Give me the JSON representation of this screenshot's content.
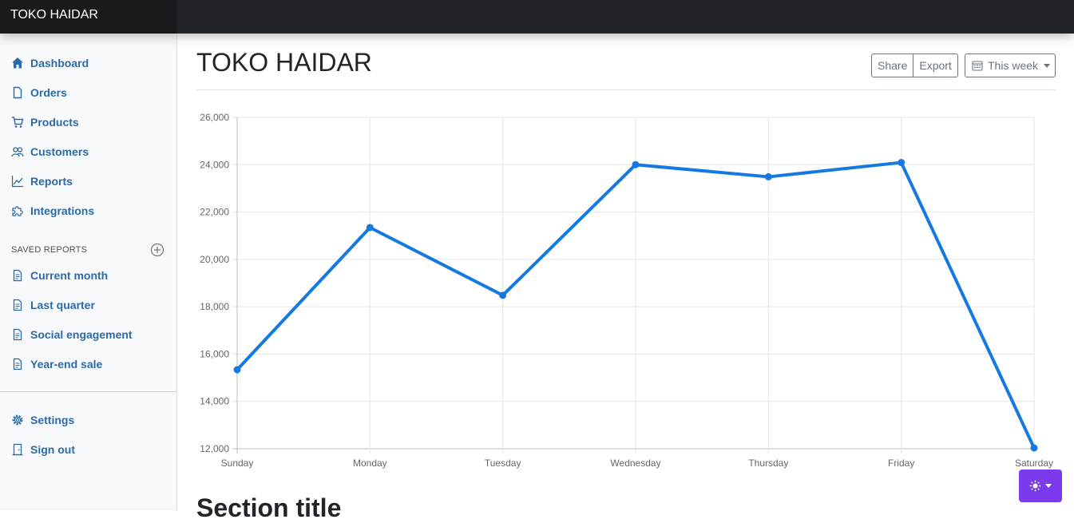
{
  "brand": "TOKO HAIDAR",
  "sidebar": {
    "items": [
      {
        "label": "Dashboard",
        "icon": "home-icon"
      },
      {
        "label": "Orders",
        "icon": "file-icon"
      },
      {
        "label": "Products",
        "icon": "cart-icon"
      },
      {
        "label": "Customers",
        "icon": "users-icon"
      },
      {
        "label": "Reports",
        "icon": "chart-line-icon"
      },
      {
        "label": "Integrations",
        "icon": "puzzle-icon"
      }
    ],
    "saved_heading": "SAVED REPORTS",
    "saved_items": [
      {
        "label": "Current month",
        "icon": "file-text-icon"
      },
      {
        "label": "Last quarter",
        "icon": "file-text-icon"
      },
      {
        "label": "Social engagement",
        "icon": "file-text-icon"
      },
      {
        "label": "Year-end sale",
        "icon": "file-text-icon"
      }
    ],
    "bottom_items": [
      {
        "label": "Settings",
        "icon": "gear-icon"
      },
      {
        "label": "Sign out",
        "icon": "door-icon"
      }
    ]
  },
  "main": {
    "title": "TOKO HAIDAR",
    "share_label": "Share",
    "export_label": "Export",
    "period_label": "This week",
    "section_title": "Section title"
  },
  "colors": {
    "accent": "#0d6efd",
    "line": "#1479e0",
    "theme_button": "#7c3aed"
  },
  "chart_data": {
    "type": "line",
    "categories": [
      "Sunday",
      "Monday",
      "Tuesday",
      "Wednesday",
      "Thursday",
      "Friday",
      "Saturday"
    ],
    "series": [
      {
        "values": [
          15339,
          21345,
          18483,
          24003,
          23489,
          24092,
          12034
        ]
      }
    ],
    "ylim": [
      12000,
      26000
    ],
    "yticks": [
      "12,000",
      "14,000",
      "16,000",
      "18,000",
      "20,000",
      "22,000",
      "24,000",
      "26,000"
    ],
    "grid": true,
    "legend": "none"
  }
}
